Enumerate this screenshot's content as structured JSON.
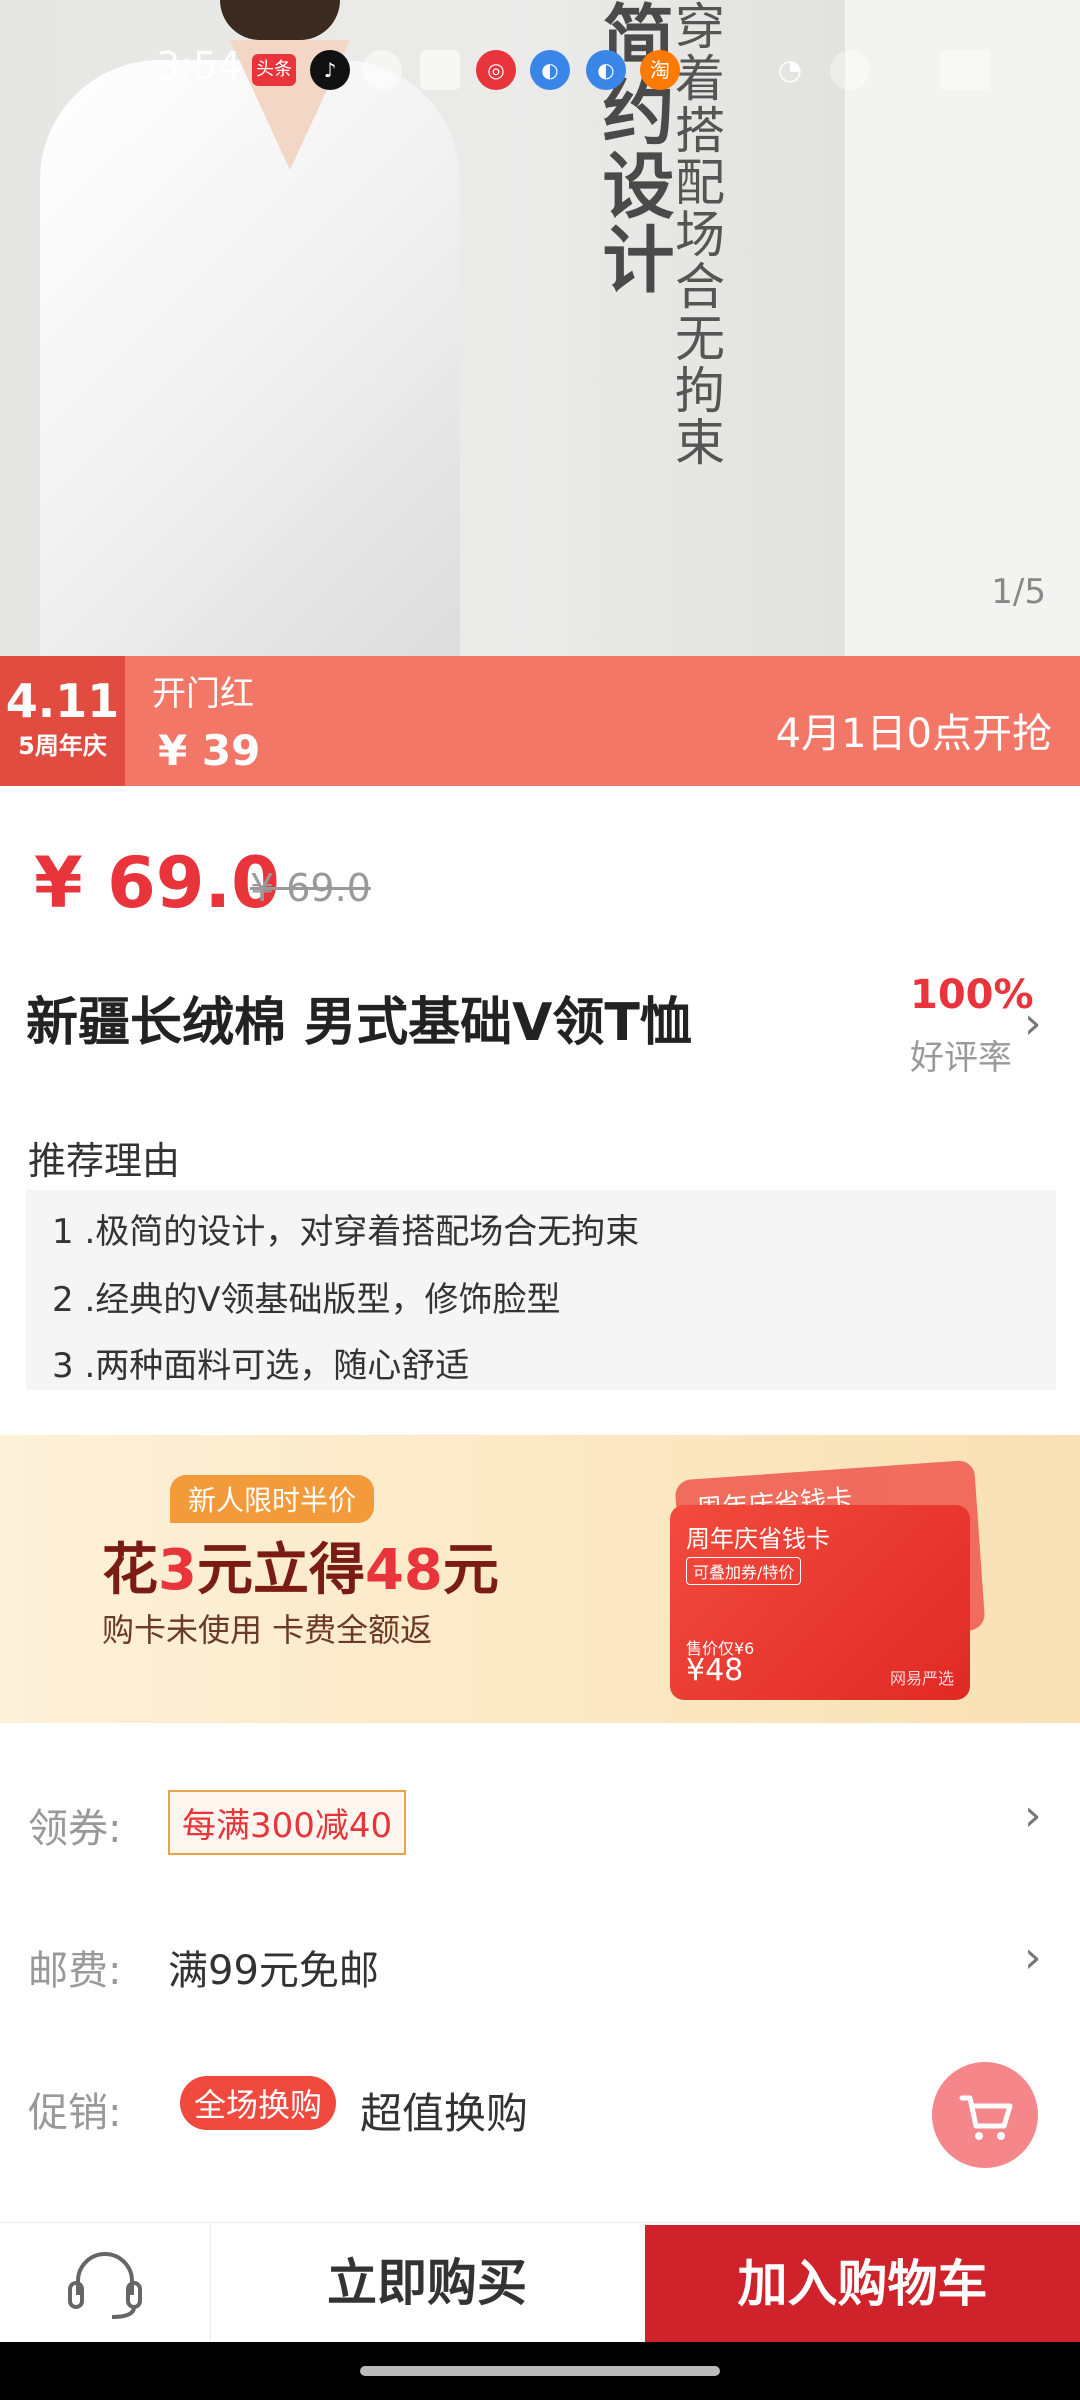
{
  "status_bar": {
    "time": "3:54",
    "app_icons": [
      "toutiao-icon",
      "douyin-icon",
      "chat-icon",
      "mail-icon",
      "netease-music-icon",
      "browser-icon",
      "browser-icon",
      "taobao-icon"
    ],
    "toutiao_label": "头条",
    "taobao_label": "淘"
  },
  "hero": {
    "vertical_text_1": "简约设计",
    "vertical_text_2": "穿着搭配场合无拘束",
    "image_counter": "1/5"
  },
  "promo": {
    "badge_number": "4.11",
    "badge_text": "5周年庆",
    "label": "开门红",
    "price": "¥ 39",
    "start_time": "4月1日0点开抢"
  },
  "price": {
    "current": "¥ 69.0",
    "original": "¥ 69.0"
  },
  "product": {
    "title": "新疆长绒棉 男式基础V领T恤",
    "rating_percent": "100%",
    "rating_label": "好评率"
  },
  "reasons": {
    "heading": "推荐理由",
    "items": [
      "1 .极简的设计，对穿着搭配场合无拘束",
      "2 .经典的V领基础版型，修饰脸型",
      "3 .两种面料可选，随心舒适"
    ]
  },
  "ad": {
    "tag": "新人限时半价",
    "headline_1": "花",
    "headline_num1": "3",
    "headline_2": "元立得",
    "headline_num2": "48",
    "headline_3": "元",
    "subline": "购卡未使用 卡费全额返",
    "card_back_title": "周年庆省钱卡",
    "card_title": "周年庆省钱卡",
    "card_badge": "可叠加券/特价",
    "card_sale": "售价仅¥6",
    "card_price": "¥48",
    "card_brand": "网易严选"
  },
  "coupon": {
    "label": "领券:",
    "value": "每满300减40"
  },
  "shipping": {
    "label": "邮费:",
    "value": "满99元免邮"
  },
  "promotion": {
    "label": "促销:",
    "pill": "全场换购",
    "value": "超值换购"
  },
  "bottom_bar": {
    "buy_now": "立即购买",
    "add_to_cart": "加入购物车"
  },
  "colors": {
    "brand_red": "#d0222b",
    "price_red": "#e8343a",
    "promo_bar": "#f37767"
  }
}
